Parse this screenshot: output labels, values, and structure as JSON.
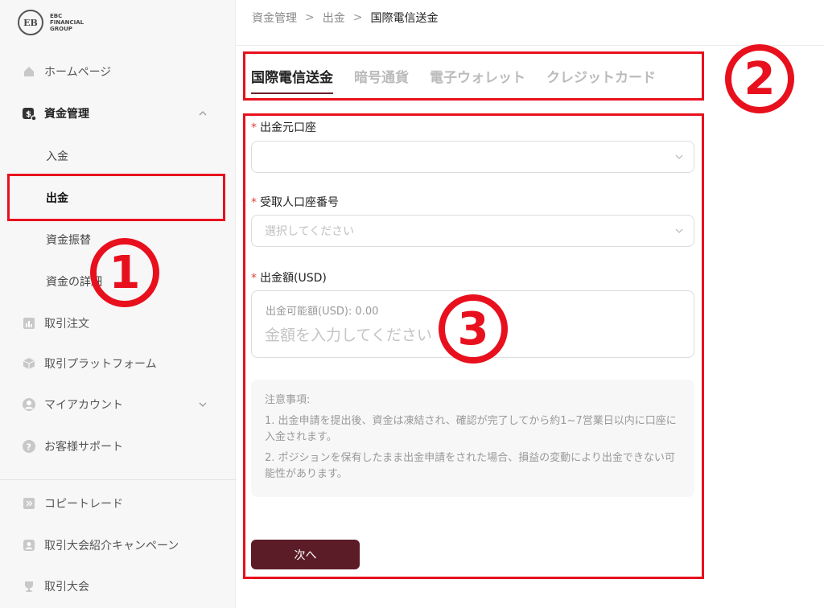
{
  "logo": {
    "mark": "EB",
    "line1": "EBC",
    "line2": "FINANCIAL",
    "line3": "GROUP"
  },
  "sidebar": {
    "home": "ホームページ",
    "funds": "資金管理",
    "deposit": "入金",
    "withdraw": "出金",
    "transfer": "資金振替",
    "funds_detail": "資金の詳細",
    "trade_order": "取引注文",
    "trade_platform": "取引プラットフォーム",
    "my_account": "マイアカウント",
    "support": "お客様サポート",
    "copy_trade": "コピートレード",
    "referral": "取引大会紹介キャンペーン",
    "contest": "取引大会"
  },
  "breadcrumb": {
    "level1": "資金管理",
    "level2": "出金",
    "current": "国際電信送金",
    "sep": ">"
  },
  "tabs": [
    "国際電信送金",
    "暗号通貨",
    "電子ウォレット",
    "クレジットカード"
  ],
  "form": {
    "source_label": "出金元口座",
    "source_value": "",
    "receiver_label": "受取人口座番号",
    "receiver_placeholder": "選択してください",
    "amount_label": "出金額(USD)",
    "available": "出金可能額(USD): 0.00",
    "amount_placeholder": "金額を入力してください",
    "required_mark": "*"
  },
  "notes": {
    "title": "注意事項:",
    "item1": "1. 出金申請を提出後、資金は凍結され、確認が完了してから約1~7営業日以内に口座に入金されます。",
    "item2": "2. ポジションを保有したまま出金申請をされた場合、損益の変動により出金できない可能性があります。"
  },
  "next_button": "次へ",
  "annotations": {
    "n1": "1",
    "n2": "2",
    "n3": "3"
  },
  "colors": {
    "accent": "#5b1c28",
    "annotation": "#e8101d",
    "required": "#e0443b"
  }
}
